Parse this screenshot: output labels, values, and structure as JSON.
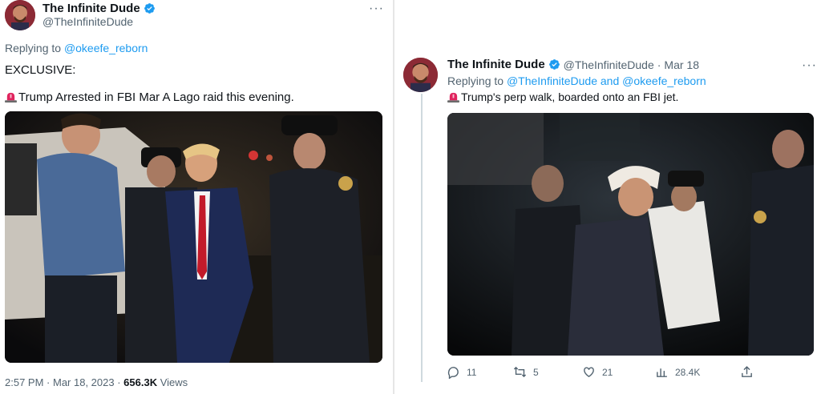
{
  "left_tweet": {
    "display_name": "The Infinite Dude",
    "handle": "@TheInfiniteDude",
    "more": "···",
    "replying_prefix": "Replying to ",
    "replying_to": "@okeefe_reborn",
    "line1": "EXCLUSIVE:",
    "line2": "Trump Arrested in FBI Mar A Lago raid this evening.",
    "time": "2:57 PM",
    "sep": " · ",
    "date": "Mar 18, 2023",
    "sep2": " · ",
    "views_count": "656.3K",
    "views_label": " Views"
  },
  "right_tweet": {
    "display_name": "The Infinite Dude",
    "handle": "@TheInfiniteDude",
    "sep": " · ",
    "date": "Mar 18",
    "more": "···",
    "replying_prefix": "Replying to ",
    "replying_to_1": "@TheInfiniteDude",
    "replying_and": " and ",
    "replying_to_2": "@okeefe_reborn",
    "text": "Trump's perp walk, boarded onto an FBI jet.",
    "actions": {
      "replies": "11",
      "retweets": "5",
      "likes": "21",
      "views": "28.4K"
    }
  },
  "icons": {
    "verified": "verified-badge-icon",
    "siren": "police-siren-icon",
    "reply": "reply-icon",
    "retweet": "retweet-icon",
    "like": "heart-icon",
    "views": "views-bar-chart-icon",
    "share": "share-icon"
  },
  "colors": {
    "link": "#1d9bf0",
    "secondary_text": "#536471",
    "verified": "#1d9bf0",
    "siren": "#e0245e"
  }
}
